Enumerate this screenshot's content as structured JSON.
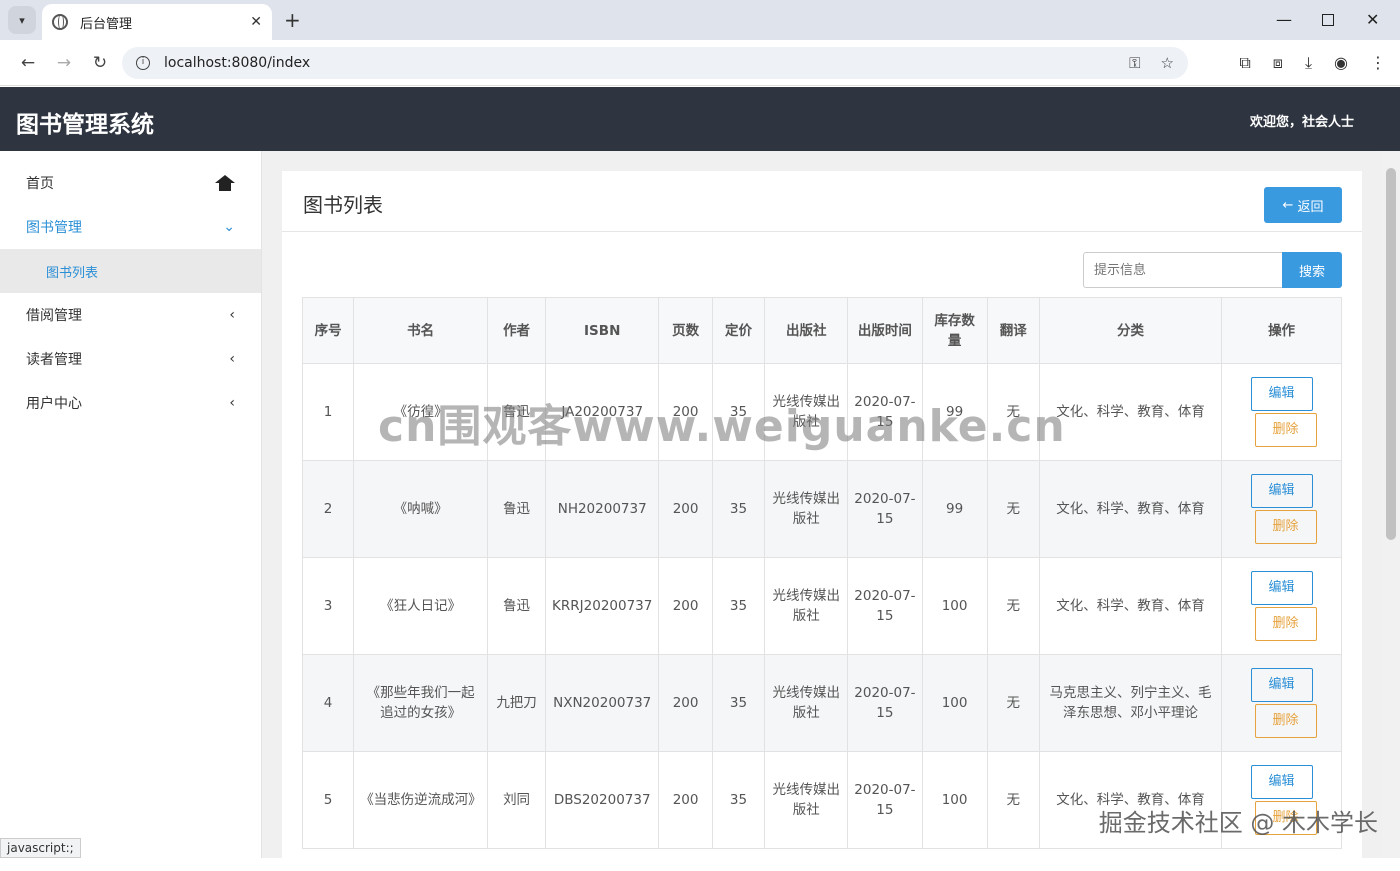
{
  "browser": {
    "tab_title": "后台管理",
    "new_tab": "+",
    "url": "localhost:8080/index"
  },
  "app": {
    "title": "图书管理系统",
    "welcome": "欢迎您，社会人士"
  },
  "sidebar": {
    "home": "首页",
    "book_mgmt": "图书管理",
    "book_list": "图书列表",
    "borrow_mgmt": "借阅管理",
    "reader_mgmt": "读者管理",
    "user_center": "用户中心"
  },
  "panel": {
    "title": "图书列表",
    "back_label": "返回",
    "search_placeholder": "提示信息",
    "search_label": "搜索"
  },
  "table": {
    "headers": [
      "序号",
      "书名",
      "作者",
      "ISBN",
      "页数",
      "定价",
      "出版社",
      "出版时间",
      "库存数量",
      "翻译",
      "分类",
      "操作"
    ],
    "edit_label": "编辑",
    "delete_label": "删除",
    "rows": [
      {
        "no": "1",
        "name": "《彷徨》",
        "author": "鲁迅",
        "isbn": "JA20200737",
        "pages": "200",
        "price": "35",
        "publisher": "光线传媒出版社",
        "date": "2020-07-15",
        "stock": "99",
        "translate": "无",
        "category": "文化、科学、教育、体育"
      },
      {
        "no": "2",
        "name": "《呐喊》",
        "author": "鲁迅",
        "isbn": "NH20200737",
        "pages": "200",
        "price": "35",
        "publisher": "光线传媒出版社",
        "date": "2020-07-15",
        "stock": "99",
        "translate": "无",
        "category": "文化、科学、教育、体育"
      },
      {
        "no": "3",
        "name": "《狂人日记》",
        "author": "鲁迅",
        "isbn": "KRRJ20200737",
        "pages": "200",
        "price": "35",
        "publisher": "光线传媒出版社",
        "date": "2020-07-15",
        "stock": "100",
        "translate": "无",
        "category": "文化、科学、教育、体育"
      },
      {
        "no": "4",
        "name": "《那些年我们一起追过的女孩》",
        "author": "九把刀",
        "isbn": "NXN20200737",
        "pages": "200",
        "price": "35",
        "publisher": "光线传媒出版社",
        "date": "2020-07-15",
        "stock": "100",
        "translate": "无",
        "category": "马克思主义、列宁主义、毛泽东思想、邓小平理论"
      },
      {
        "no": "5",
        "name": "《当悲伤逆流成河》",
        "author": "刘同",
        "isbn": "DBS20200737",
        "pages": "200",
        "price": "35",
        "publisher": "光线传媒出版社",
        "date": "2020-07-15",
        "stock": "100",
        "translate": "无",
        "category": "文化、科学、教育、体育"
      }
    ]
  },
  "watermarks": {
    "center": "cn围观客www.weiguanke.cn",
    "corner": "掘金技术社区 @ 木木学长"
  },
  "statusbar": "javascript:;"
}
